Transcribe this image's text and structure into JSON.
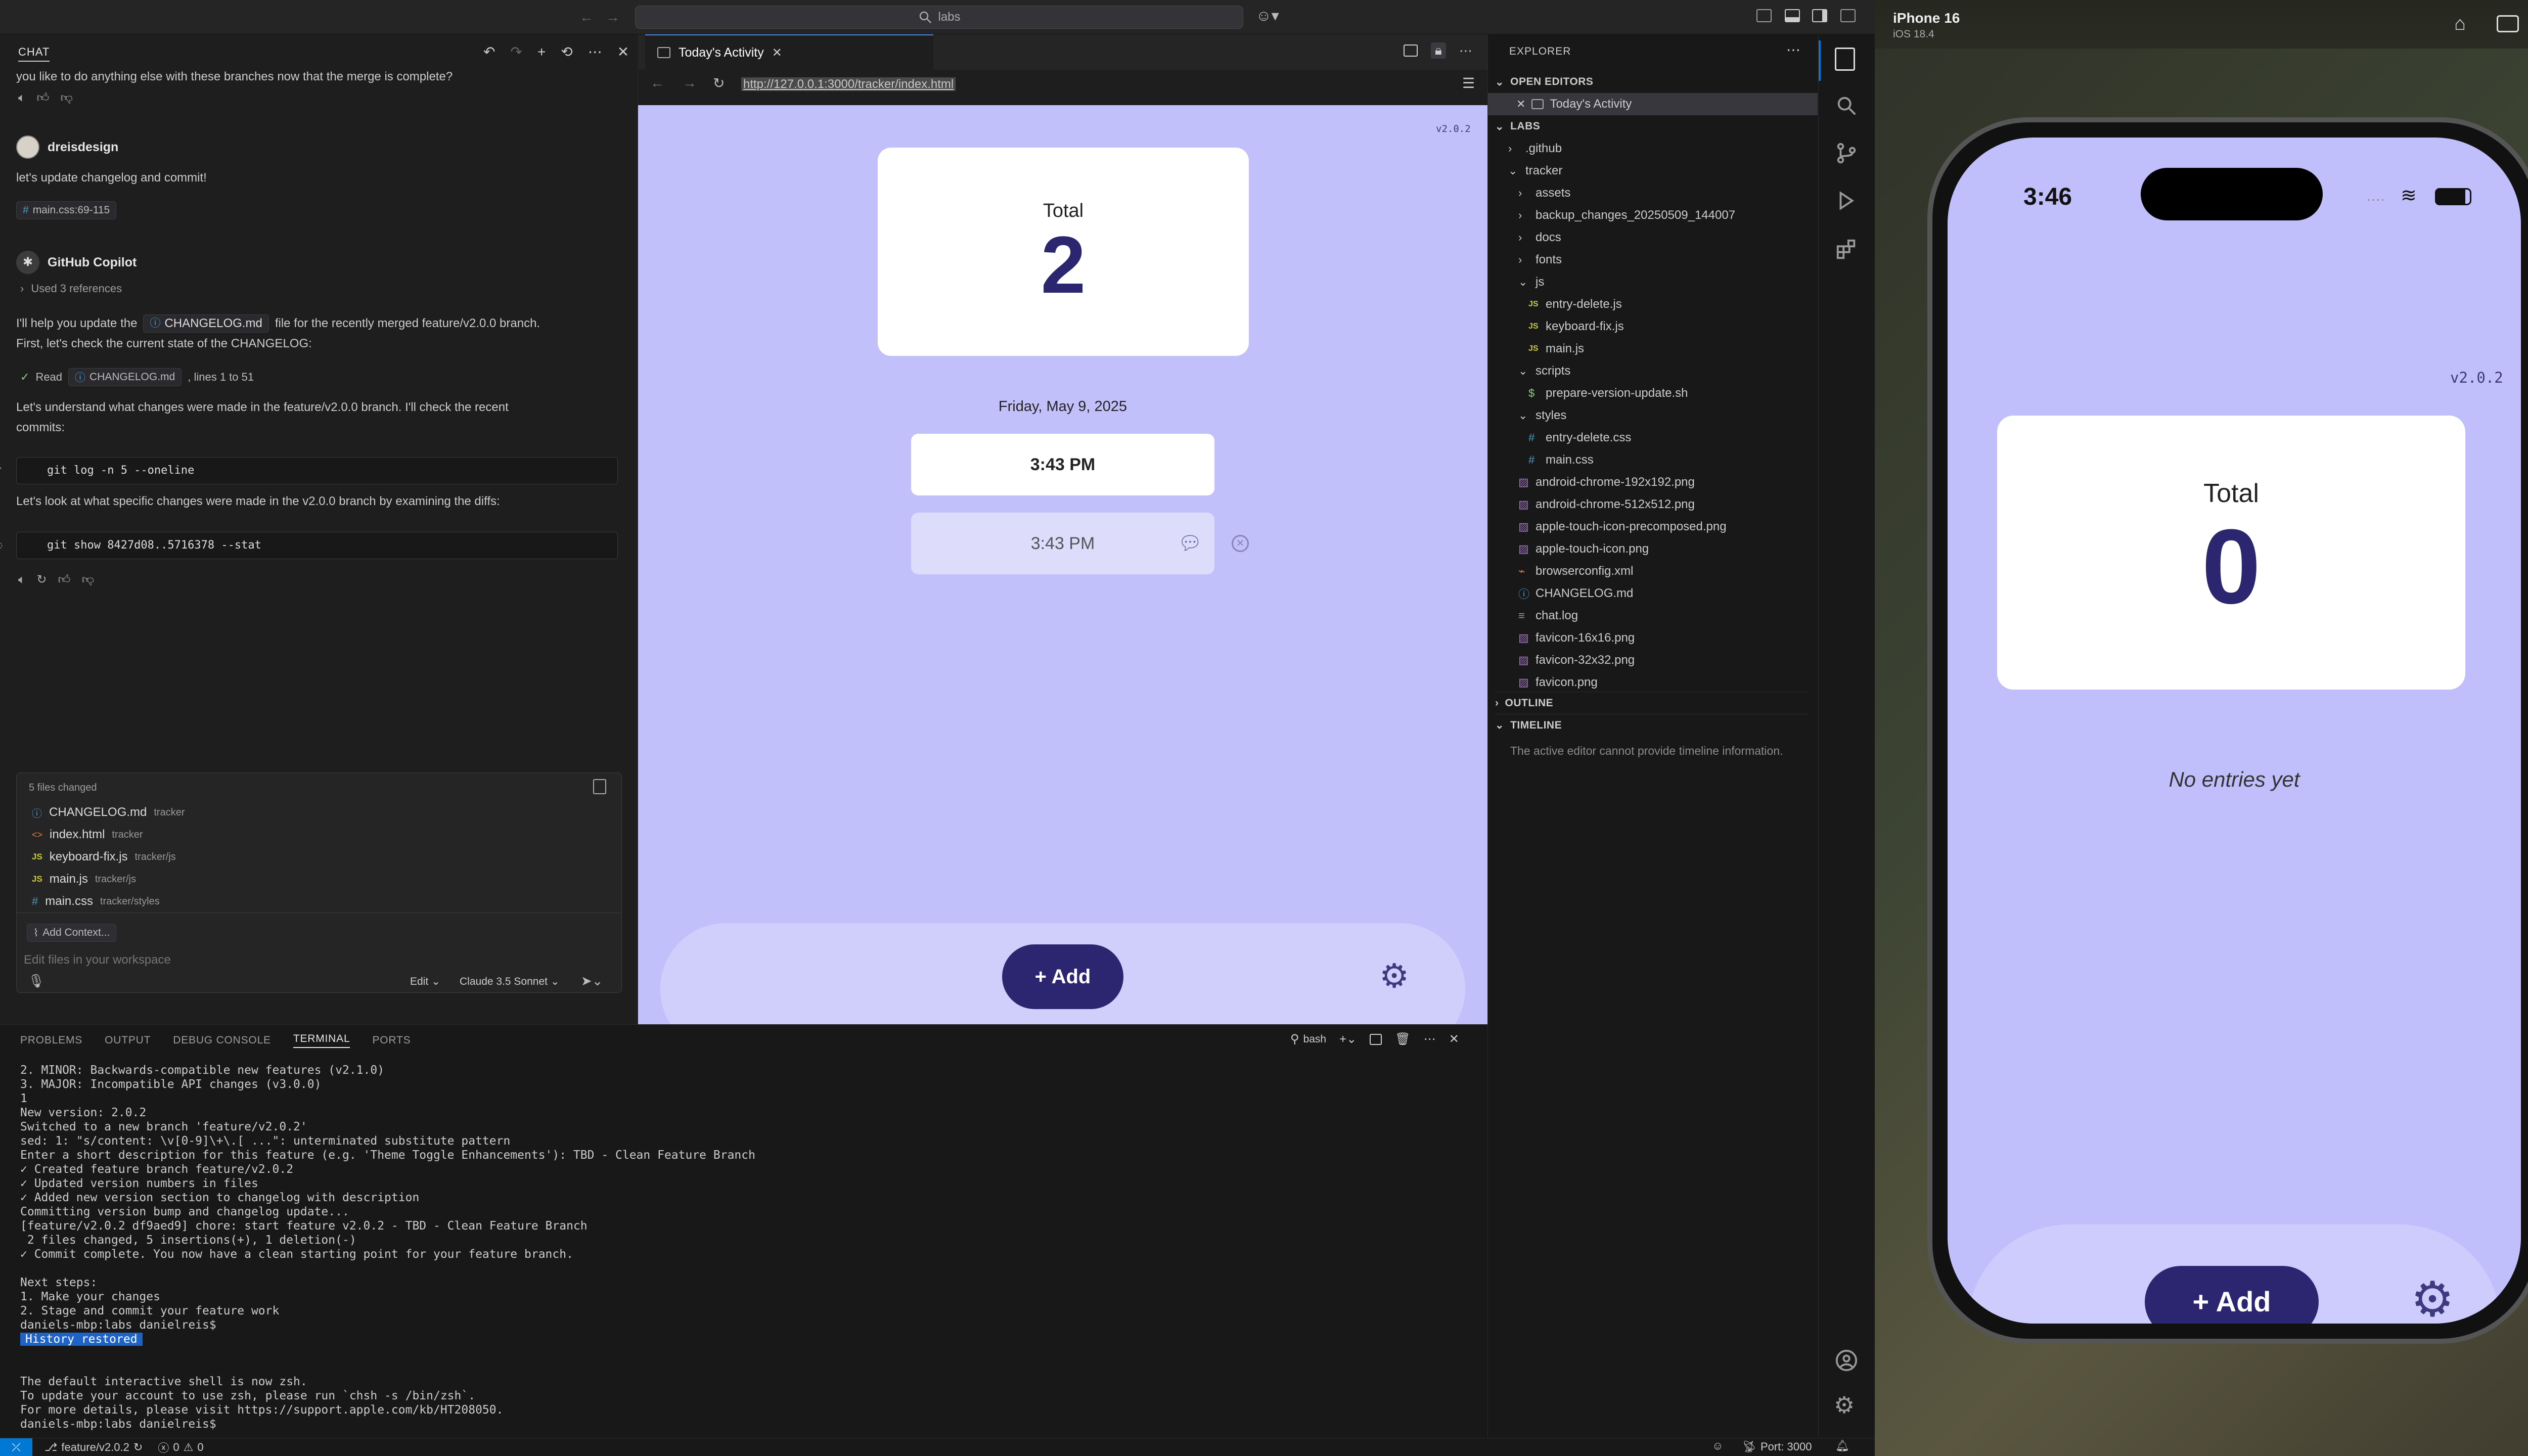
{
  "titlebar": {
    "command_center": "labs"
  },
  "chat": {
    "title": "CHAT",
    "intro_line": "you like to do anything else with these branches now that the merge is complete?",
    "user": {
      "name": "dreisdesign",
      "message": "let's update changelog and commit!",
      "attachment": "main.css:69-115"
    },
    "assistant": {
      "name": "GitHub Copilot",
      "references": "Used 3 references",
      "p1a": "I'll help you update the",
      "p1_file": "CHANGELOG.md",
      "p1b": "file for the recently merged feature/v2.0.0 branch.",
      "p1c": "First, let's check the current state of the CHANGELOG:",
      "read_label": "Read",
      "read_file": "CHANGELOG.md",
      "read_range": ", lines 1 to 51",
      "p2": "Let's understand what changes were made in the feature/v2.0.0 branch. I'll check the recent",
      "p2b": "commits:",
      "cmd1": "git log -n 5 --oneline",
      "p3": "Let's look at what specific changes were made in the v2.0.0 branch by examining the diffs:",
      "cmd2": "git show 8427d08..5716378 --stat"
    },
    "files_changed": {
      "header": "5 files changed",
      "files": [
        {
          "name": "CHANGELOG.md",
          "path": "tracker",
          "icon": "info-file-icon",
          "color": "#4a9cd6"
        },
        {
          "name": "index.html",
          "path": "tracker",
          "icon": "html-file-icon",
          "color": "#e37933"
        },
        {
          "name": "keyboard-fix.js",
          "path": "tracker/js",
          "icon": "js-file-icon",
          "color": "#cbcb41"
        },
        {
          "name": "main.js",
          "path": "tracker/js",
          "icon": "js-file-icon",
          "color": "#cbcb41"
        },
        {
          "name": "main.css",
          "path": "tracker/styles",
          "icon": "css-file-icon",
          "color": "#519aba"
        }
      ]
    },
    "add_context": "Add Context...",
    "input_placeholder": "Edit files in your workspace",
    "mode": "Edit",
    "model": "Claude 3.5 Sonnet"
  },
  "browser": {
    "tab_title": "Today's Activity",
    "url": "http://127.0.0.1:3000/tracker/index.html",
    "app": {
      "version": "v2.0.2",
      "total_label": "Total",
      "total_value": "2",
      "date": "Friday, May 9, 2025",
      "entries": [
        {
          "time": "3:43 PM"
        },
        {
          "time": "3:43 PM"
        }
      ],
      "add_label": "+ Add"
    }
  },
  "explorer": {
    "title": "EXPLORER",
    "open_editors_label": "OPEN EDITORS",
    "open_editor": "Today's Activity",
    "workspace_label": "LABS",
    "tree": [
      {
        "name": ".github",
        "kind": "folder-closed",
        "level": 0
      },
      {
        "name": "tracker",
        "kind": "folder-open",
        "level": 0
      },
      {
        "name": "assets",
        "kind": "folder-closed",
        "level": 1
      },
      {
        "name": "backup_changes_20250509_144007",
        "kind": "folder-closed",
        "level": 1
      },
      {
        "name": "docs",
        "kind": "folder-closed",
        "level": 1
      },
      {
        "name": "fonts",
        "kind": "folder-closed",
        "level": 1
      },
      {
        "name": "js",
        "kind": "folder-open",
        "level": 1
      },
      {
        "name": "entry-delete.js",
        "kind": "js",
        "level": 2
      },
      {
        "name": "keyboard-fix.js",
        "kind": "js",
        "level": 2
      },
      {
        "name": "main.js",
        "kind": "js",
        "level": 2
      },
      {
        "name": "scripts",
        "kind": "folder-open",
        "level": 1
      },
      {
        "name": "prepare-version-update.sh",
        "kind": "sh",
        "level": 2
      },
      {
        "name": "styles",
        "kind": "folder-open",
        "level": 1
      },
      {
        "name": "entry-delete.css",
        "kind": "css",
        "level": 2
      },
      {
        "name": "main.css",
        "kind": "css",
        "level": 2
      },
      {
        "name": "android-chrome-192x192.png",
        "kind": "img",
        "level": 1
      },
      {
        "name": "android-chrome-512x512.png",
        "kind": "img",
        "level": 1
      },
      {
        "name": "apple-touch-icon-precomposed.png",
        "kind": "img",
        "level": 1
      },
      {
        "name": "apple-touch-icon.png",
        "kind": "img",
        "level": 1
      },
      {
        "name": "browserconfig.xml",
        "kind": "xml",
        "level": 1
      },
      {
        "name": "CHANGELOG.md",
        "kind": "md",
        "level": 1
      },
      {
        "name": "chat.log",
        "kind": "log",
        "level": 1
      },
      {
        "name": "favicon-16x16.png",
        "kind": "img",
        "level": 1
      },
      {
        "name": "favicon-32x32.png",
        "kind": "img",
        "level": 1
      },
      {
        "name": "favicon.png",
        "kind": "img",
        "level": 1
      }
    ],
    "outline_label": "OUTLINE",
    "timeline_label": "TIMELINE",
    "timeline_message": "The active editor cannot provide timeline information."
  },
  "panel": {
    "tabs": [
      "PROBLEMS",
      "OUTPUT",
      "DEBUG CONSOLE",
      "TERMINAL",
      "PORTS"
    ],
    "active_tab": "TERMINAL",
    "shell": "bash",
    "terminal_lines": [
      "2. MINOR: Backwards-compatible new features (v2.1.0)",
      "3. MAJOR: Incompatible API changes (v3.0.0)",
      "1",
      "New version: 2.0.2",
      "Switched to a new branch 'feature/v2.0.2'",
      "sed: 1: \"s/content: \\v[0-9]\\+\\.[ ...\": unterminated substitute pattern",
      "Enter a short description for this feature (e.g. 'Theme Toggle Enhancements'): TBD - Clean Feature Branch",
      "✓ Created feature branch feature/v2.0.2",
      "✓ Updated version numbers in files",
      "✓ Added new version section to changelog with description",
      "Committing version bump and changelog update...",
      "[feature/v2.0.2 df9aed9] chore: start feature v2.0.2 - TBD - Clean Feature Branch",
      " 2 files changed, 5 insertions(+), 1 deletion(-)",
      "✓ Commit complete. You now have a clean starting point for your feature branch.",
      "",
      "Next steps:",
      "1. Make your changes",
      "2. Stage and commit your feature work",
      "daniels-mbp:labs danielreis$"
    ],
    "history_restored": "History restored",
    "terminal_tail": [
      "",
      "",
      "The default interactive shell is now zsh.",
      "To update your account to use zsh, please run `chsh -s /bin/zsh`.",
      "For more details, please visit https://support.apple.com/kb/HT208050.",
      "daniels-mbp:labs danielreis$"
    ]
  },
  "statusbar": {
    "branch": "feature/v2.0.2",
    "problems": "0",
    "warnings": "0",
    "port": "Port: 3000"
  },
  "simulator": {
    "device": "iPhone 16",
    "os": "iOS 18.4",
    "time": "3:46",
    "app": {
      "version": "v2.0.2",
      "total_label": "Total",
      "total_value": "0",
      "empty": "No entries yet",
      "add_label": "+ Add"
    }
  }
}
